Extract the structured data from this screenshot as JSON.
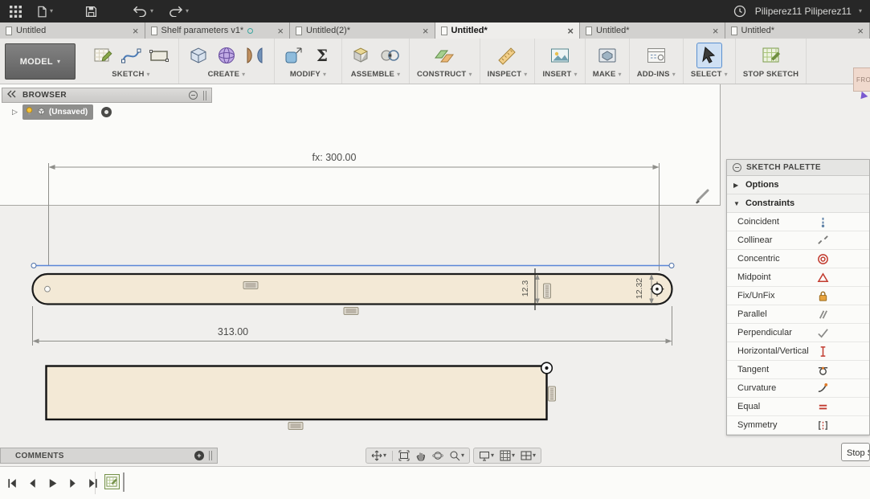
{
  "colors": {
    "topbar_bg": "#272727",
    "ribbon_bg": "#ebeae8",
    "canvas_bg": "#f0efed",
    "profile_fill": "#f3e9d6",
    "profile_stroke": "#1b1b1b",
    "selected_blue": "#5b86d7",
    "highlight_select": "#cfe0f3"
  },
  "topbar": {
    "user": "Piliperez11 Piliperez11",
    "icons": [
      "app-grid-icon",
      "file-menu-icon",
      "save-icon",
      "undo-icon",
      "redo-icon",
      "clock-icon",
      "chevron-down-icon"
    ]
  },
  "tabs": [
    {
      "label": "Untitled"
    },
    {
      "label": "Shelf parameters v1*",
      "shared": true
    },
    {
      "label": "Untitled(2)*"
    },
    {
      "label": "Untitled*",
      "active": true
    },
    {
      "label": "Untitled*"
    },
    {
      "label": "Untitled*"
    }
  ],
  "ribbon": {
    "workspace": "MODEL",
    "groups": [
      {
        "label": "SKETCH",
        "icons": [
          "sketch-icon",
          "spline-icon",
          "rectangle-icon"
        ]
      },
      {
        "label": "CREATE",
        "icons": [
          "box-icon",
          "sphere-icon",
          "loft-icon"
        ]
      },
      {
        "label": "MODIFY",
        "icons": [
          "press-pull-icon",
          "parameters-sigma-icon"
        ]
      },
      {
        "label": "ASSEMBLE",
        "icons": [
          "new-component-icon",
          "joint-icon"
        ]
      },
      {
        "label": "CONSTRUCT",
        "icons": [
          "plane-icon"
        ]
      },
      {
        "label": "INSPECT",
        "icons": [
          "measure-icon"
        ]
      },
      {
        "label": "INSERT",
        "icons": [
          "insert-image-icon"
        ]
      },
      {
        "label": "MAKE",
        "icons": [
          "make-icon"
        ]
      },
      {
        "label": "ADD-INS",
        "icons": [
          "addins-icon"
        ]
      },
      {
        "label": "SELECT",
        "icons": [
          "select-cursor-icon"
        ],
        "selected": true
      },
      {
        "label": "STOP SKETCH",
        "icons": [
          "stop-sketch-icon"
        ],
        "no_caret": true
      }
    ]
  },
  "browser": {
    "title": "BROWSER",
    "item": "(Unsaved)"
  },
  "viewcube": {
    "label": "FRO"
  },
  "sketch": {
    "dim_top": "fx: 300.00",
    "dim_width": "313.00",
    "dim_height_left": "12.3",
    "dim_height_right": "12.32"
  },
  "palette": {
    "title": "SKETCH PALETTE",
    "options_label": "Options",
    "constraints_label": "Constraints",
    "constraints": [
      {
        "label": "Coincident",
        "icon": "coincident-icon"
      },
      {
        "label": "Collinear",
        "icon": "collinear-icon"
      },
      {
        "label": "Concentric",
        "icon": "concentric-icon"
      },
      {
        "label": "Midpoint",
        "icon": "midpoint-icon"
      },
      {
        "label": "Fix/UnFix",
        "icon": "lock-icon"
      },
      {
        "label": "Parallel",
        "icon": "parallel-icon"
      },
      {
        "label": "Perpendicular",
        "icon": "perpendicular-icon"
      },
      {
        "label": "Horizontal/Vertical",
        "icon": "horizontal-vertical-icon"
      },
      {
        "label": "Tangent",
        "icon": "tangent-icon"
      },
      {
        "label": "Curvature",
        "icon": "curvature-icon"
      },
      {
        "label": "Equal",
        "icon": "equal-icon"
      },
      {
        "label": "Symmetry",
        "icon": "symmetry-icon"
      }
    ],
    "stop_button": "Stop S"
  },
  "comments": {
    "label": "COMMENTS"
  },
  "navbar": {
    "icons": [
      "move-icon",
      "fit-icon",
      "pan-hand-icon",
      "orbit-icon",
      "zoom-icon",
      "display-settings-icon",
      "grid-settings-icon",
      "viewports-icon"
    ]
  },
  "timeline": {
    "icons": [
      "skip-start-icon",
      "step-back-icon",
      "play-icon",
      "step-forward-icon",
      "skip-end-icon",
      "sketch-feature-icon"
    ]
  }
}
